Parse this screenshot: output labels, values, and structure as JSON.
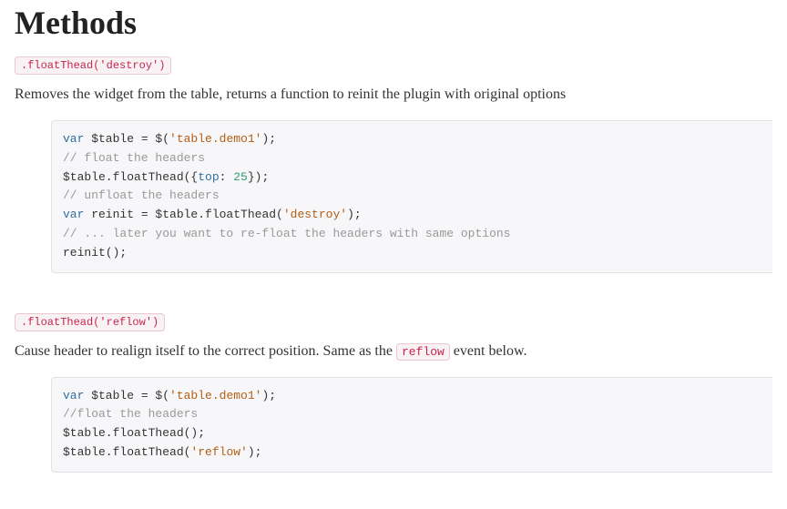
{
  "title": "Methods",
  "sections": [
    {
      "label": ".floatThead('destroy')",
      "description_pre": "Removes the widget from the table, returns a function to reinit the plugin with original options",
      "description_post": "",
      "inline_code": "",
      "code_tokens": [
        {
          "t": "kw",
          "v": "var"
        },
        {
          "t": "",
          "v": " $table = $("
        },
        {
          "t": "str",
          "v": "'table.demo1'"
        },
        {
          "t": "",
          "v": ");\n"
        },
        {
          "t": "com",
          "v": "// float the headers"
        },
        {
          "t": "",
          "v": "\n"
        },
        {
          "t": "",
          "v": "$table.floatThead({"
        },
        {
          "t": "prop",
          "v": "top"
        },
        {
          "t": "",
          "v": ": "
        },
        {
          "t": "num",
          "v": "25"
        },
        {
          "t": "",
          "v": "});\n"
        },
        {
          "t": "com",
          "v": "// unfloat the headers"
        },
        {
          "t": "",
          "v": "\n"
        },
        {
          "t": "kw",
          "v": "var"
        },
        {
          "t": "",
          "v": " reinit = $table.floatThead("
        },
        {
          "t": "str",
          "v": "'destroy'"
        },
        {
          "t": "",
          "v": ");\n"
        },
        {
          "t": "com",
          "v": "// ... later you want to re-float the headers with same options"
        },
        {
          "t": "",
          "v": "\n"
        },
        {
          "t": "",
          "v": "reinit();"
        }
      ]
    },
    {
      "label": ".floatThead('reflow')",
      "description_pre": "Cause header to realign itself to the correct position. Same as the ",
      "description_post": " event below.",
      "inline_code": "reflow",
      "code_tokens": [
        {
          "t": "kw",
          "v": "var"
        },
        {
          "t": "",
          "v": " $table = $("
        },
        {
          "t": "str",
          "v": "'table.demo1'"
        },
        {
          "t": "",
          "v": ");\n"
        },
        {
          "t": "com",
          "v": "//float the headers"
        },
        {
          "t": "",
          "v": "\n"
        },
        {
          "t": "",
          "v": "$table.floatThead();\n"
        },
        {
          "t": "",
          "v": "$table.floatThead("
        },
        {
          "t": "str",
          "v": "'reflow'"
        },
        {
          "t": "",
          "v": ");"
        }
      ]
    }
  ]
}
